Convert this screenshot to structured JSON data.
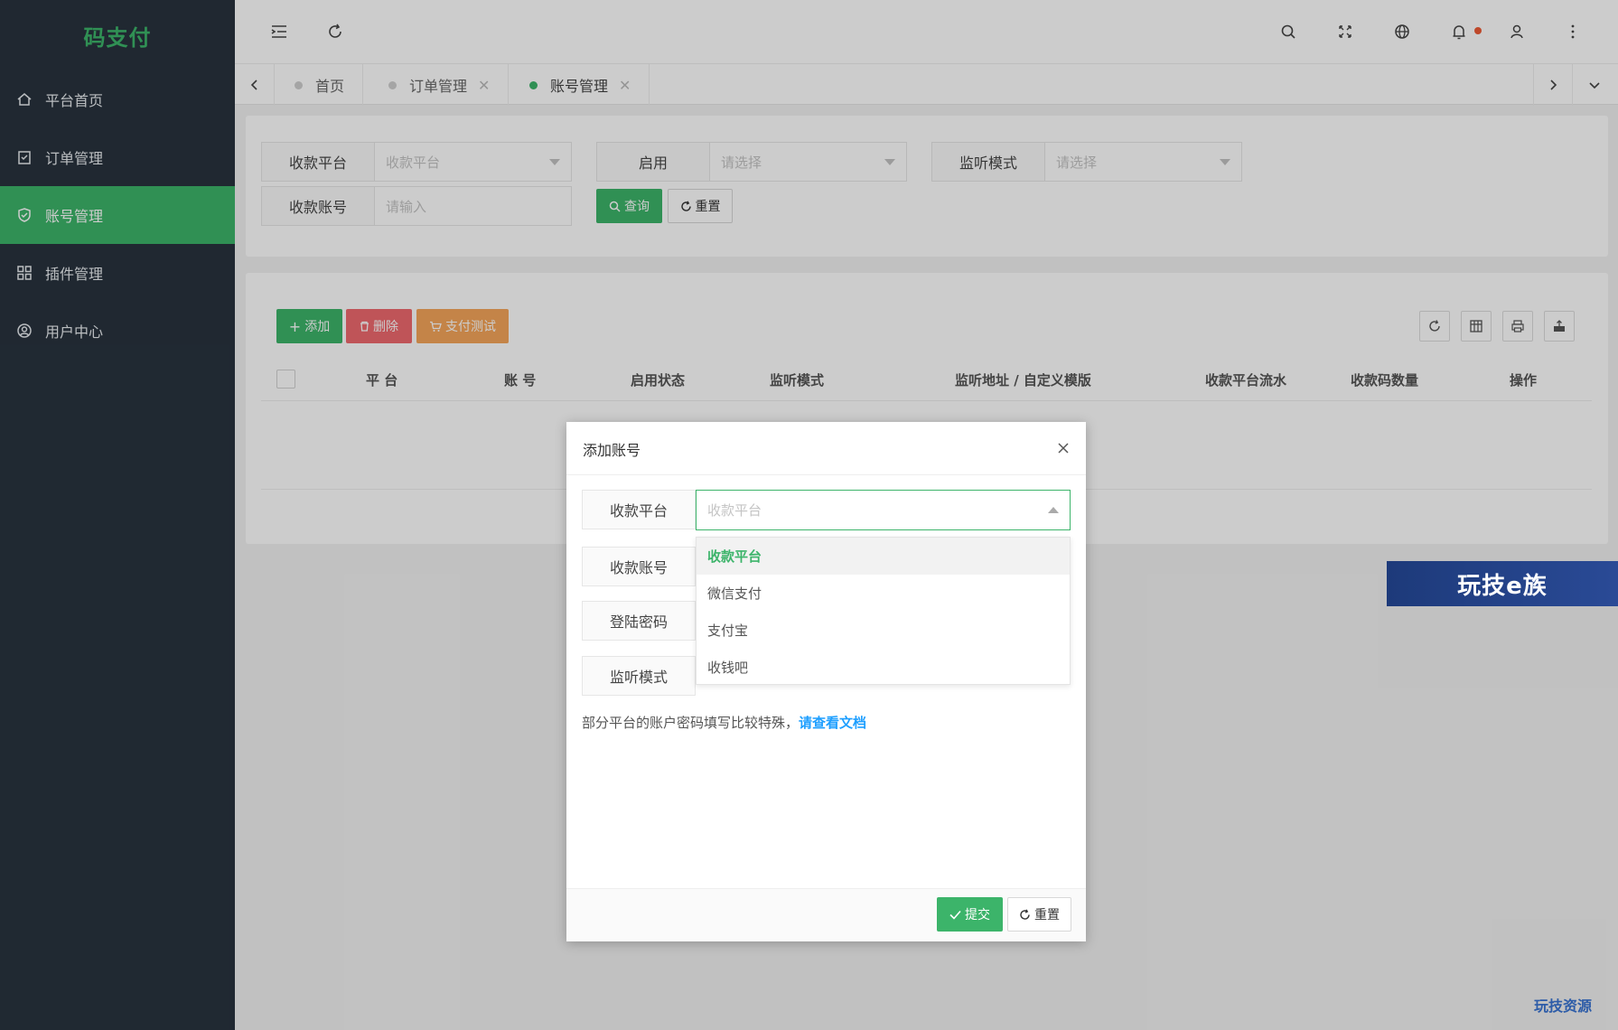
{
  "app": {
    "brand": "码支付"
  },
  "sidebar": {
    "items": [
      {
        "label": "平台首页",
        "icon": "home-icon"
      },
      {
        "label": "订单管理",
        "icon": "clipboard-icon"
      },
      {
        "label": "账号管理",
        "icon": "shield-check-icon"
      },
      {
        "label": "插件管理",
        "icon": "grid-icon"
      },
      {
        "label": "用户中心",
        "icon": "user-circle-icon"
      }
    ],
    "active_index": 2
  },
  "tabs": [
    {
      "label": "首页",
      "closable": false
    },
    {
      "label": "订单管理",
      "closable": true
    },
    {
      "label": "账号管理",
      "closable": true,
      "active": true
    }
  ],
  "close_glyph": "✕",
  "filter": {
    "platform_label": "收款平台",
    "platform_placeholder": "收款平台",
    "enabled_label": "启用",
    "enabled_placeholder": "请选择",
    "monitor_label": "监听模式",
    "monitor_placeholder": "请选择",
    "account_label": "收款账号",
    "account_placeholder": "请输入",
    "search_button": "查询",
    "reset_button": "重置"
  },
  "toolbar": {
    "add_button": "添加",
    "delete_button": "删除",
    "pay_test_button": "支付测试"
  },
  "table": {
    "columns": [
      "平 台",
      "账 号",
      "启用状态",
      "监听模式",
      "监听地址 / 自定义模版",
      "收款平台流水",
      "收款码数量",
      "操作"
    ]
  },
  "modal": {
    "title": "添加账号",
    "fields": {
      "platform_label": "收款平台",
      "platform_placeholder": "收款平台",
      "account_label": "收款账号",
      "password_label": "登陆密码",
      "monitor_label": "监听模式"
    },
    "dropdown_options": [
      "收款平台",
      "微信支付",
      "支付宝",
      "收钱吧"
    ],
    "selected_option_index": 0,
    "note": "部分平台的账户密码填写比较特殊，",
    "note_link": "请查看文档",
    "submit_button": "提交",
    "reset_button": "重置"
  },
  "colors": {
    "accent": "#3cb46a",
    "sidebar_bg": "#28333e",
    "danger": "#ef6a6f",
    "warning": "#f5a55a",
    "link": "#1e9fff"
  },
  "watermark": {
    "banner": "玩技e族",
    "corner": "玩技资源"
  }
}
